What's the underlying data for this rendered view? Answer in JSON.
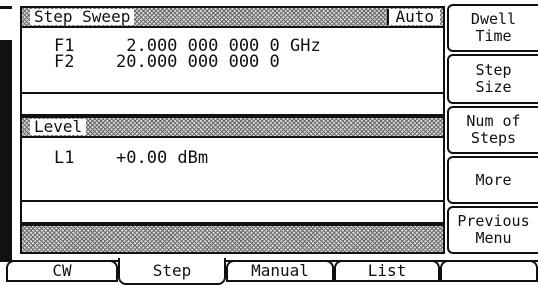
{
  "step_sweep": {
    "title": "Step Sweep",
    "mode_tag": "Auto",
    "rows": [
      {
        "label": "F1",
        "value": " 2.000 000 000 0 GHz"
      },
      {
        "label": "F2",
        "value": "20.000 000 000 0"
      }
    ]
  },
  "level": {
    "title": "Level",
    "rows": [
      {
        "label": "L1",
        "value": "+0.00 dBm"
      }
    ]
  },
  "softkeys": [
    {
      "line1": "Dwell",
      "line2": "Time"
    },
    {
      "line1": "Step",
      "line2": "Size"
    },
    {
      "line1": "Num of",
      "line2": "Steps"
    },
    {
      "line1": "More",
      "line2": ""
    },
    {
      "line1": "Previous",
      "line2": "Menu"
    }
  ],
  "tabs": [
    {
      "label": "CW",
      "active": false
    },
    {
      "label": "Step",
      "active": true
    },
    {
      "label": "Manual",
      "active": false
    },
    {
      "label": "List",
      "active": false
    }
  ]
}
